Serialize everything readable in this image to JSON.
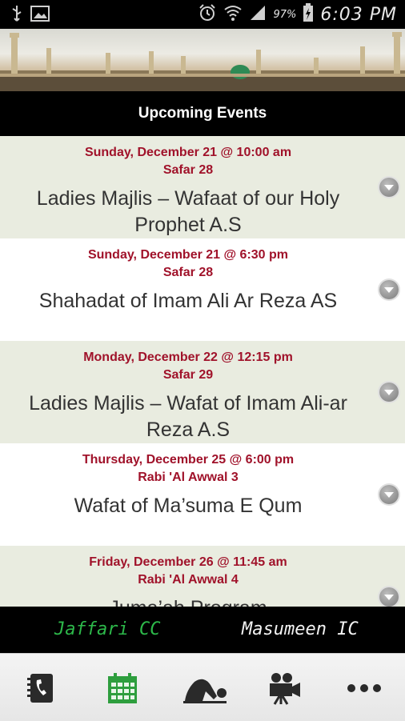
{
  "status_bar": {
    "battery": "97%",
    "time": "6:03 PM",
    "icons": [
      "usb-icon",
      "image-icon",
      "alarm-icon",
      "wifi-icon",
      "signal-icon",
      "battery-icon"
    ]
  },
  "header": {
    "title": "Upcoming Events"
  },
  "events": [
    {
      "date": "Sunday, December 21 @ 10:00 am",
      "hijri": "Safar 28",
      "title": "Ladies Majlis – Wafaat of our Holy Prophet A.S"
    },
    {
      "date": "Sunday, December 21 @ 6:30 pm",
      "hijri": "Safar 28",
      "title": "Shahadat of Imam Ali Ar Reza AS"
    },
    {
      "date": "Monday, December 22 @ 12:15 pm",
      "hijri": "Safar 29",
      "title": "Ladies Majlis – Wafat of Imam Ali-ar Reza A.S"
    },
    {
      "date": "Thursday, December 25 @ 6:00 pm",
      "hijri": "Rabi 'Al Awwal 3",
      "title": "Wafat of Ma’suma E Qum"
    },
    {
      "date": "Friday, December 26 @ 11:45 am",
      "hijri": "Rabi 'Al Awwal 4",
      "title": "Juma’ah Program"
    }
  ],
  "tabs": {
    "left": "Jaffari CC",
    "right": "Masumeen IC"
  },
  "bottom_nav": [
    "contacts-icon",
    "calendar-icon",
    "prayer-icon",
    "video-icon",
    "more-icon"
  ],
  "colors": {
    "date_text": "#a0122a",
    "alt_row": "#e9ece0",
    "active_tab": "#2db84a",
    "calendar_green": "#2e9e3e"
  }
}
